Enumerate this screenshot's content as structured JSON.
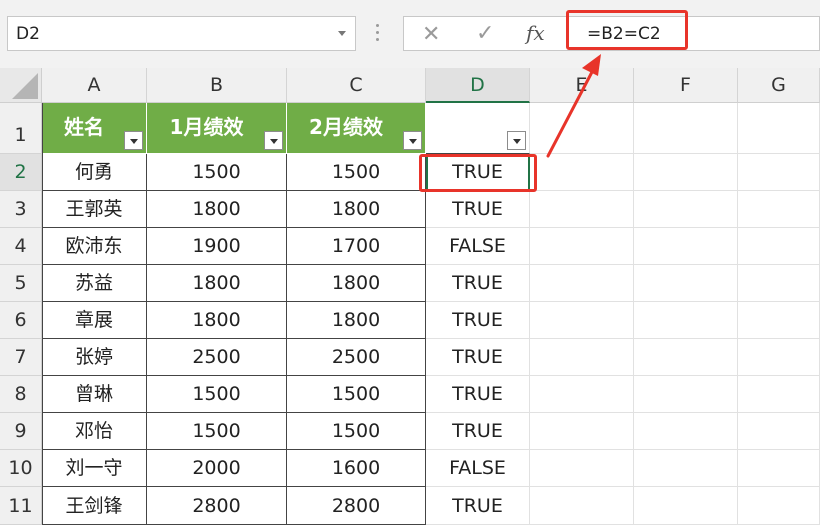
{
  "formula_bar": {
    "name_box": "D2",
    "cancel_icon": "✕",
    "enter_icon": "✓",
    "fx_label": "fx",
    "formula": "=B2=C2"
  },
  "columns": [
    "A",
    "B",
    "C",
    "D",
    "E",
    "F",
    "G"
  ],
  "active_column": "D",
  "active_row": "2",
  "rows": [
    "1",
    "2",
    "3",
    "4",
    "5",
    "6",
    "7",
    "8",
    "9",
    "10",
    "11"
  ],
  "table_headers": [
    "姓名",
    "1月绩效",
    "2月绩效",
    ""
  ],
  "table_rows": [
    [
      "何勇",
      "1500",
      "1500",
      "TRUE"
    ],
    [
      "王郭英",
      "1800",
      "1800",
      "TRUE"
    ],
    [
      "欧沛东",
      "1900",
      "1700",
      "FALSE"
    ],
    [
      "苏益",
      "1800",
      "1800",
      "TRUE"
    ],
    [
      "章展",
      "1800",
      "1800",
      "TRUE"
    ],
    [
      "张婷",
      "2500",
      "2500",
      "TRUE"
    ],
    [
      "曾琳",
      "1500",
      "1500",
      "TRUE"
    ],
    [
      "邓怡",
      "1500",
      "1500",
      "TRUE"
    ],
    [
      "刘一守",
      "2000",
      "1600",
      "FALSE"
    ],
    [
      "王剑锋",
      "2800",
      "2800",
      "TRUE"
    ]
  ],
  "colors": {
    "header_fill": "#70ad47",
    "accent": "#217346",
    "annotation": "#e8342a"
  }
}
